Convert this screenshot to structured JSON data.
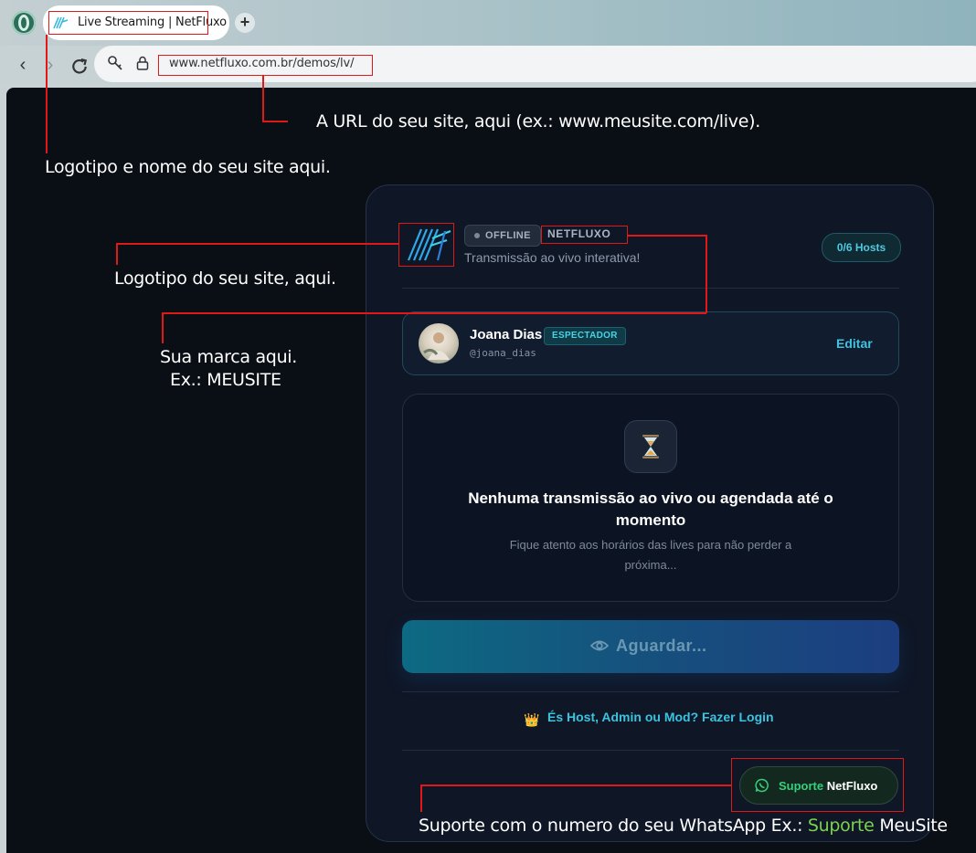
{
  "browser": {
    "tab_title": "Live Streaming | NetFluxo",
    "url": "www.netfluxo.com.br/demos/lv/"
  },
  "card": {
    "status": "OFFLINE",
    "brand": "NETFLUXO",
    "tagline": "Transmissão ao vivo interativa!",
    "hosts": "0/6 Hosts",
    "user": {
      "name": "Joana Dias",
      "role": "ESPECTADOR",
      "handle": "@joana_dias",
      "edit": "Editar"
    },
    "empty": {
      "title": "Nenhuma transmissão ao vivo ou agendada até o momento",
      "subtitle": "Fique atento aos horários das lives para não perder a próxima..."
    },
    "wait_label": "Aguardar...",
    "login_link": "És Host, Admin ou Mod? Fazer Login",
    "support": {
      "prefix": "Suporte",
      "brand": "NetFluxo"
    }
  },
  "annotations": {
    "url": "A URL do seu site, aqui (ex.: www.meusite.com/live).",
    "tab": "Logotipo e nome do seu site aqui.",
    "logo": "Logotipo do seu site, aqui.",
    "brand_line1": "Sua marca aqui.",
    "brand_line2": "Ex.: MEUSITE",
    "support_prefix": "Suporte com o numero do seu WhatsApp Ex.:",
    "support_green": "Suporte",
    "support_brand": "MeuSite"
  },
  "colors": {
    "accent": "#3fc2df",
    "annotation_red": "#e01818",
    "whatsapp_green": "#35d07a"
  }
}
